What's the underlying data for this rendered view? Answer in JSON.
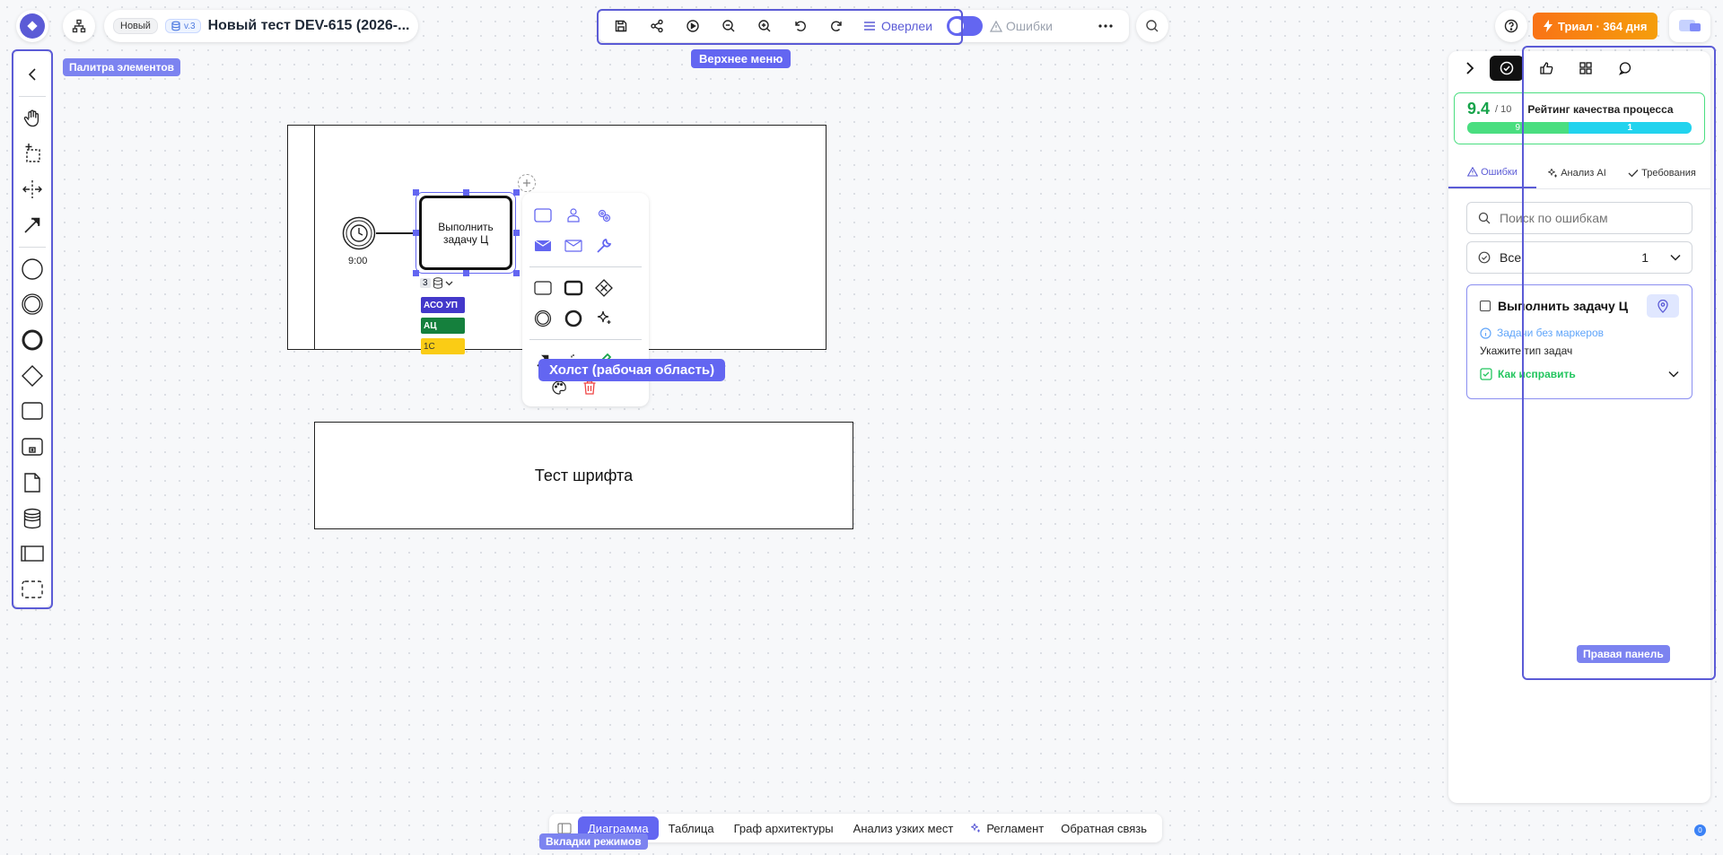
{
  "header": {
    "status_badge": "Новый",
    "version": "v.3",
    "doc_title": "Новый тест DEV-615 (2026-..."
  },
  "toolbar": {
    "overlays_label": "Оверлеи",
    "errors_label": "Ошибки"
  },
  "trial": {
    "label": "Триал · 364 дня"
  },
  "annotations": {
    "top_menu": "Верхнее меню",
    "palette": "Палитра элементов",
    "canvas": "Холст (рабочая область)",
    "right_panel": "Правая панель",
    "mode_tabs": "Вкладки режимов"
  },
  "canvas": {
    "timer_label": "9:00",
    "task_text": "Выполнить задачу Ц",
    "marker_count": "3",
    "tags": [
      {
        "label": "АСО УП",
        "color": "#4338ca"
      },
      {
        "label": "АЦ",
        "color": "#15803d"
      },
      {
        "label": "1С",
        "color": "#facc15"
      }
    ],
    "text_box": "Тест шрифта"
  },
  "right_panel": {
    "score": "9.4",
    "score_max": "/ 10",
    "rating_title": "Рейтинг качества процесса",
    "bar_green_value": "9",
    "bar_blue_value": "1",
    "tabs": [
      "Ошибки",
      "Анализ AI",
      "Требования"
    ],
    "search_placeholder": "Поиск по ошибкам",
    "filter_value": "Все",
    "filter_count": "1",
    "error_card": {
      "title": "Выполнить задачу Ц",
      "issue": "Задачи без маркеров",
      "description": "Укажите тип задач",
      "fix_label": "Как исправить"
    }
  },
  "bottom_tabs": [
    "Диаграмма",
    "Таблица",
    "Граф архитектуры",
    "Анализ узких мест",
    "Регламент",
    "Обратная связь"
  ],
  "corner_badge": "0",
  "colors": {
    "accent": "#5b5bd6",
    "trial": "#f97316",
    "score_green": "#16a34a",
    "bar_green": "#4ade80",
    "bar_blue": "#22d3ee"
  }
}
